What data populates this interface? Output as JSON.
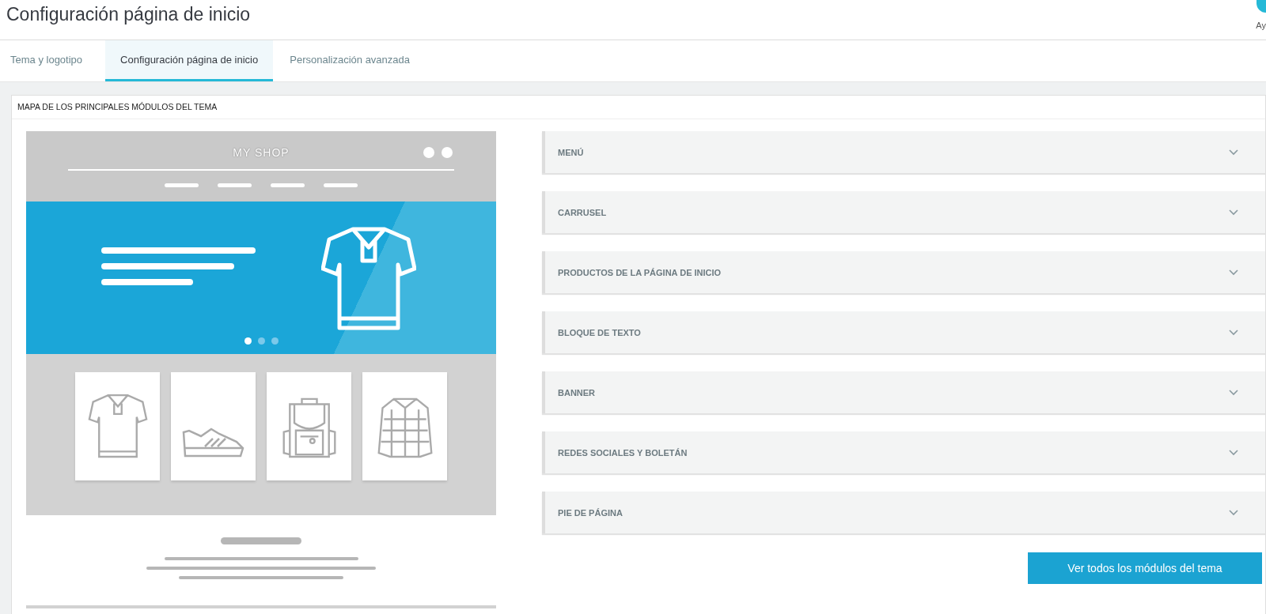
{
  "header": {
    "title": "Configuración página de inicio",
    "help_label": "Ay"
  },
  "tabs": [
    {
      "label": "Tema y logotipo",
      "selected": false
    },
    {
      "label": "Configuración página de inicio",
      "selected": true
    },
    {
      "label": "Personalización avanzada",
      "selected": false
    }
  ],
  "panel": {
    "title": "MAPA DE LOS PRINCIPALES MÓDULOS DEL TEMA",
    "mockup": {
      "shop_name": "MY SHOP"
    },
    "modules": [
      {
        "label": "MENÚ",
        "expanded": false
      },
      {
        "label": "CARRUSEL",
        "expanded": false
      },
      {
        "label": "PRODUCTOS DE LA PÁGINA DE INICIO",
        "expanded": false
      },
      {
        "label": "BLOQUE DE TEXTO",
        "expanded": false
      },
      {
        "label": "BANNER",
        "expanded": false
      },
      {
        "label": "REDES SOCIALES Y BOLETÁN",
        "expanded": false
      },
      {
        "label": "PIE DE PÁGINA",
        "expanded": false
      }
    ],
    "button": "Ver todos los módulos del tema"
  }
}
